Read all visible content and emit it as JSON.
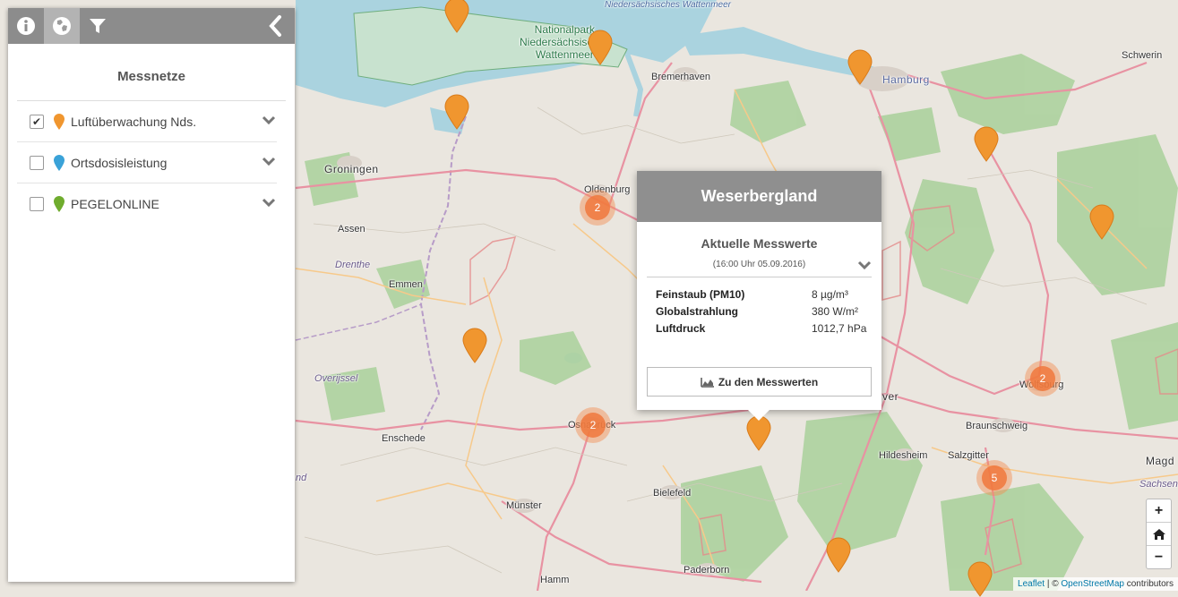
{
  "panel": {
    "tabs": [
      {
        "name": "info-icon"
      },
      {
        "name": "globe-icon"
      },
      {
        "name": "filter-icon"
      }
    ],
    "title": "Messnetze",
    "networks": [
      {
        "label": "Luftüberwachung Nds.",
        "checked": true,
        "color": "#f0962f"
      },
      {
        "label": "Ortsdosisleistung",
        "checked": false,
        "color": "#3aa2d8"
      },
      {
        "label": "PEGELONLINE",
        "checked": false,
        "color": "#6fac2e"
      }
    ]
  },
  "popup": {
    "title": "Weserbergland",
    "subtitle": "Aktuelle Messwerte",
    "time": "(16:00 Uhr 05.09.2016)",
    "rows": [
      {
        "key": "Feinstaub (PM10)",
        "value": "8 µg/m³"
      },
      {
        "key": "Globalstrahlung",
        "value": "380 W/m²"
      },
      {
        "key": "Luftdruck",
        "value": "1012,7 hPa"
      }
    ],
    "button": "Zu den Messwerten"
  },
  "map": {
    "places": [
      "Nationalpark",
      "Niedersächsisches",
      "Wattenmeer",
      "Niedersächsisches Wattenmeer",
      "Bremerhaven",
      "Hamburg",
      "Schwerin",
      "Groningen",
      "Oldenburg",
      "Assen",
      "Drenthe",
      "Emmen",
      "Overijssel",
      "Enschede",
      "Osnabrück",
      "Bielefeld",
      "Münster",
      "Paderborn",
      "Hamm",
      "Hildesheim",
      "Salzgitter",
      "Braunschweig",
      "Wolfsburg",
      "Magd",
      "Sachsen",
      "nd",
      "ag",
      "ver"
    ],
    "clusters": [
      "2",
      "2",
      "2",
      "5"
    ]
  },
  "zoom": {
    "in": "+",
    "out": "−"
  },
  "attribution": {
    "leaflet": "Leaflet",
    "sep": " | © ",
    "osm": "OpenStreetMap",
    "suffix": " contributors"
  }
}
